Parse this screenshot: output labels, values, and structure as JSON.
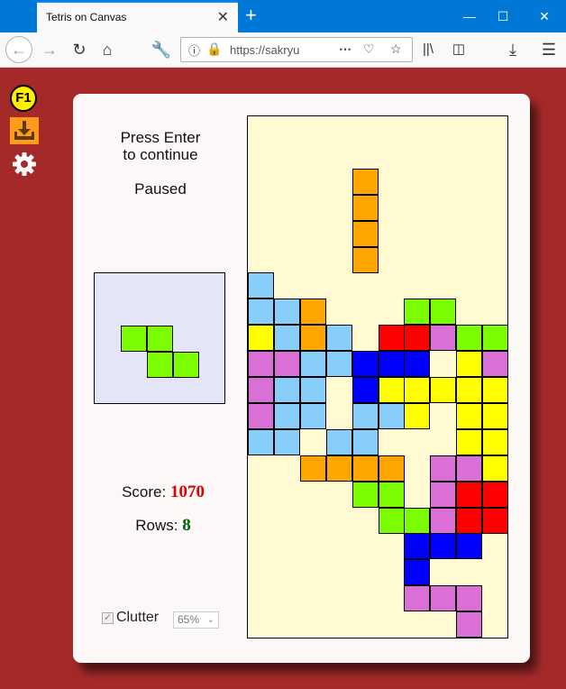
{
  "browser": {
    "tab_title": "Tetris on Canvas",
    "url": "https://sakryu",
    "new_tab_label": "+",
    "tab_close_label": "✕"
  },
  "side": {
    "help_label": "F1"
  },
  "game": {
    "message_line1": "Press Enter",
    "message_line2": "to continue",
    "status": "Paused",
    "score_label": "Score:",
    "score": "1070",
    "rows_label": "Rows:",
    "rows": "8",
    "clutter_label": "Clutter",
    "clutter_value": "65%",
    "colors": {
      "O": "#ffa500",
      "C": "#87cefa",
      "G": "#7cfc00",
      "Y": "#ffff00",
      "R": "#ff0000",
      "M": "#da70d6",
      "B": "#0000ff",
      "score_color": "#dd0000",
      "rows_color": "#006400"
    },
    "board_rows": [
      "..........",
      "..........",
      "....O.....",
      "....O.....",
      "....O.....",
      "....O.....",
      "C.........",
      "CCO...GG..",
      "YCOC.RRMGG",
      "MMCCBBB.YM",
      "MCC.BYYYYY",
      "MCC.CCY.YY",
      "CC.CC...YY",
      "..OOOO.MMY",
      "....GG.MRR",
      ".....GGMRR",
      "......BBB.",
      "......B...",
      "......MMM.",
      "........M."
    ],
    "preview_cells": [
      [
        1,
        2
      ],
      [
        2,
        2
      ],
      [
        2,
        3
      ],
      [
        3,
        3
      ]
    ]
  }
}
